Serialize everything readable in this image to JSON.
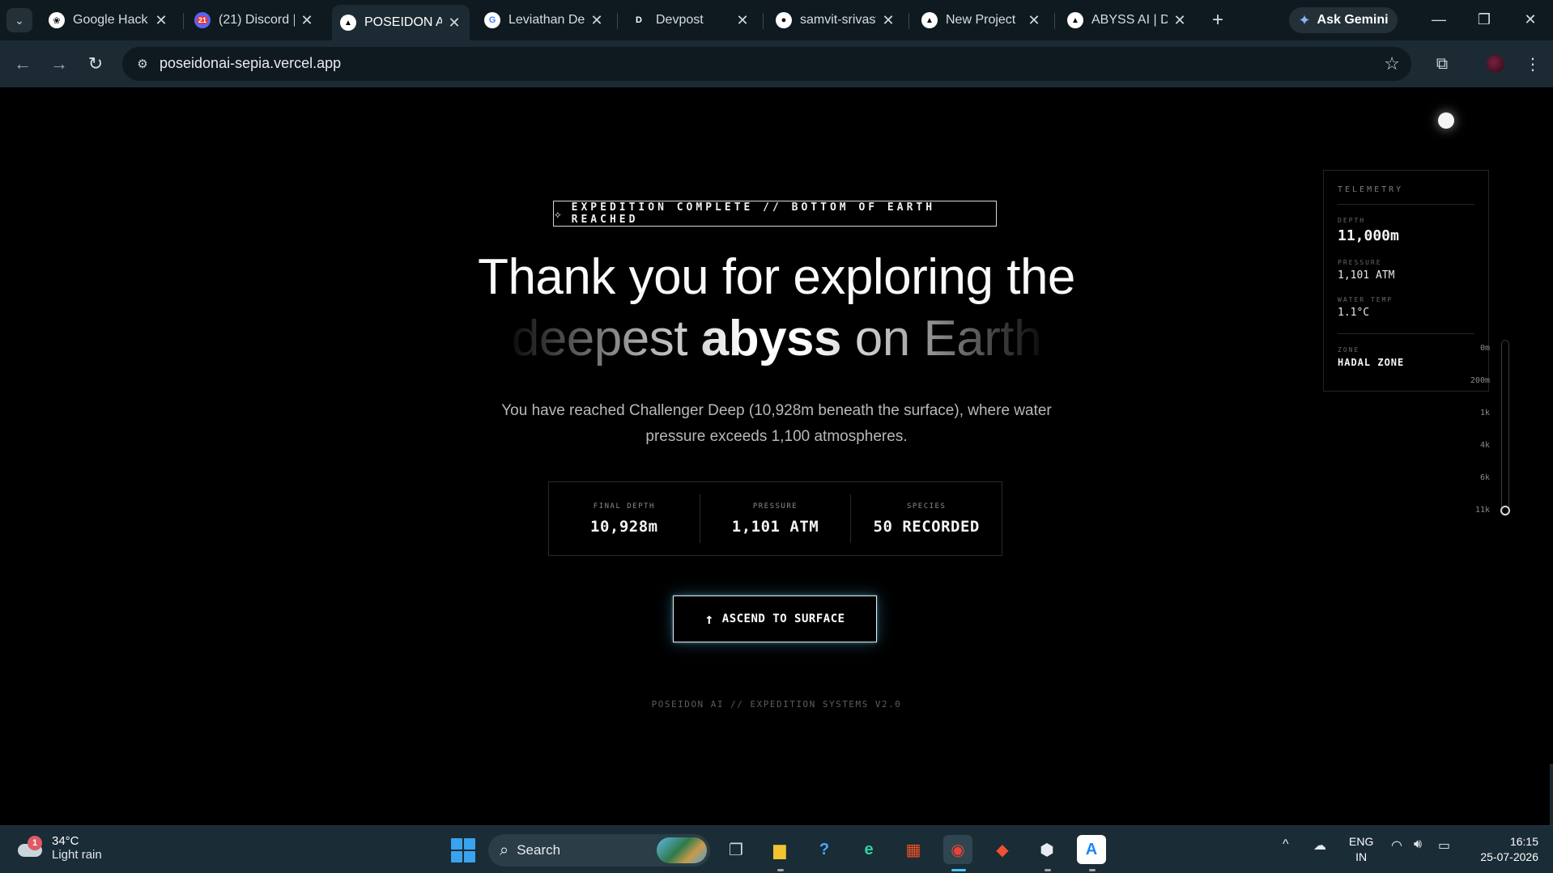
{
  "browser": {
    "tabs": [
      {
        "title": "Google Hack",
        "icon": "openai-icon"
      },
      {
        "title": "(21) Discord |",
        "icon": "discord-icon",
        "badge": "21"
      },
      {
        "title": "POSEIDON AI",
        "icon": "triangle-logo-icon",
        "active": true
      },
      {
        "title": "Leviathan De",
        "icon": "google-icon"
      },
      {
        "title": "Devpost",
        "icon": "devpost-icon"
      },
      {
        "title": "samvit-srivast",
        "icon": "github-icon"
      },
      {
        "title": "New Project",
        "icon": "triangle-logo-icon"
      },
      {
        "title": "ABYSS AI | De",
        "icon": "triangle-logo-icon"
      }
    ],
    "ask_gemini": "Ask Gemini",
    "url": "poseidonai-sepia.vercel.app"
  },
  "page": {
    "badge": "EXPEDITION COMPLETE // BOTTOM OF EARTH REACHED",
    "headline_line1": "Thank you for exploring the",
    "headline_word1": "deepest",
    "headline_word2": "abyss",
    "headline_word3": "on Earth",
    "subtitle": "You have reached Challenger Deep (10,928m beneath the surface), where water pressure exceeds 1,100 atmospheres.",
    "stats": [
      {
        "label": "FINAL DEPTH",
        "value": "10,928m"
      },
      {
        "label": "PRESSURE",
        "value": "1,101 ATM"
      },
      {
        "label": "SPECIES",
        "value": "50 RECORDED"
      }
    ],
    "ascend_label": "ASCEND TO SURFACE",
    "footer": "POSEIDON AI // EXPEDITION SYSTEMS V2.0"
  },
  "telemetry": {
    "title": "TELEMETRY",
    "depth_label": "DEPTH",
    "depth_value": "11,000m",
    "pressure_label": "PRESSURE",
    "pressure_value": "1,101 ATM",
    "temp_label": "WATER TEMP",
    "temp_value": "1.1°C",
    "zone_label": "ZONE",
    "zone_value": "HADAL ZONE"
  },
  "depth_scale": {
    "ticks": [
      "0m",
      "200m",
      "1k",
      "4k",
      "6k",
      "11k"
    ],
    "current_fraction": 1.0
  },
  "taskbar": {
    "weather_temp": "34°C",
    "weather_desc": "Light rain",
    "weather_badge": "1",
    "search_placeholder": "Search",
    "lang_line1": "ENG",
    "lang_line2": "IN",
    "time": "16:15",
    "date": "25-07-2026"
  },
  "colors": {
    "page_bg": "#000000",
    "chrome_bg": "#0f1a20",
    "toolbar_bg": "#1c2a33",
    "ascend_glow": "#50c8ff",
    "taskbar_bg": "#1a2c36"
  }
}
